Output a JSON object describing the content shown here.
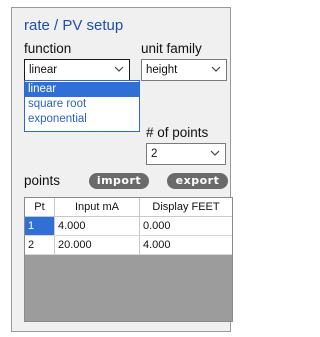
{
  "title": "rate / PV setup",
  "function": {
    "label": "function",
    "selected": "linear",
    "options": [
      "linear",
      "square root",
      "exponential"
    ],
    "highlighted_index": 0
  },
  "unit_family": {
    "label": "unit family",
    "selected": "height"
  },
  "num_points": {
    "label": "# of points",
    "selected": "2"
  },
  "points": {
    "label": "points",
    "import_label": "import",
    "export_label": "export",
    "columns": [
      "Pt",
      "Input mA",
      "Display FEET"
    ],
    "rows": [
      [
        "1",
        "4.000",
        "0.000"
      ],
      [
        "2",
        "20.000",
        "4.000"
      ]
    ],
    "selected_row": 0
  },
  "colors": {
    "title": "#1f4fa5",
    "selection": "#2f6fd6",
    "button": "#6a6a6a",
    "table_empty": "#9c9c9c"
  }
}
